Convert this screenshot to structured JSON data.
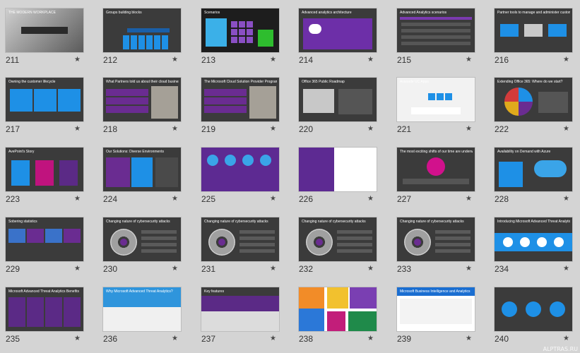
{
  "colors": {
    "background": "#d4d4d4",
    "slide_dark": "#3b3b3b",
    "accent_blue": "#1e90e6",
    "accent_purple": "#6a2c91",
    "accent_magenta": "#d1118c",
    "accent_green": "#2ebd2e"
  },
  "star_glyph": "★",
  "watermark": "ALPTRAS.RU",
  "slides": [
    {
      "number": "211",
      "title": "THE MODERN WORKPLACE",
      "kind": "photo"
    },
    {
      "number": "212",
      "title": "Groups building blocks",
      "kind": "blue_tiles"
    },
    {
      "number": "213",
      "title": "Scenarios",
      "kind": "scenarios"
    },
    {
      "number": "214",
      "title": "Advanced analytics architecture",
      "kind": "architecture"
    },
    {
      "number": "215",
      "title": "Advanced Analytics scenarios",
      "kind": "purple_list"
    },
    {
      "number": "216",
      "title": "Partner tools to manage and administer customers",
      "kind": "tools"
    },
    {
      "number": "217",
      "title": "Owning the customer lifecycle",
      "kind": "blue_three"
    },
    {
      "number": "218",
      "title": "What Partners told us about their cloud business",
      "kind": "partners"
    },
    {
      "number": "219",
      "title": "The Microsoft Cloud Solution Provider Program",
      "kind": "partners"
    },
    {
      "number": "220",
      "title": "Office 365 Public Roadmap",
      "kind": "roadmap"
    },
    {
      "number": "221",
      "title": "Avanade UC Apps",
      "kind": "skype"
    },
    {
      "number": "222",
      "title": "Extending Office 365: Where do we start?",
      "kind": "wheel"
    },
    {
      "number": "223",
      "title": "AvePoint's Story",
      "kind": "story"
    },
    {
      "number": "224",
      "title": "Our Solutions: Diverse Environments",
      "kind": "solutions"
    },
    {
      "number": "225",
      "title": "",
      "kind": "purple_stats"
    },
    {
      "number": "226",
      "title": "",
      "kind": "purple_split"
    },
    {
      "number": "227",
      "title": "The most exciting shifts of our time are underway",
      "kind": "magenta"
    },
    {
      "number": "228",
      "title": "Availability on Demand with Azure",
      "kind": "azure"
    },
    {
      "number": "229",
      "title": "Sobering statistics",
      "kind": "sobering"
    },
    {
      "number": "230",
      "title": "Changing nature of cybersecurity attacks",
      "kind": "cyber"
    },
    {
      "number": "231",
      "title": "Changing nature of cybersecurity attacks",
      "kind": "cyber"
    },
    {
      "number": "232",
      "title": "Changing nature of cybersecurity attacks",
      "kind": "cyber"
    },
    {
      "number": "233",
      "title": "Changing nature of cybersecurity attacks",
      "kind": "cyber"
    },
    {
      "number": "234",
      "title": "Introducing Microsoft Advanced Threat Analytics",
      "kind": "ata_intro"
    },
    {
      "number": "235",
      "title": "Microsoft Advanced Threat Analytics Benefits",
      "kind": "ata_benefits"
    },
    {
      "number": "236",
      "title": "Why Microsoft Advanced Threat Analytics?",
      "kind": "ata_why"
    },
    {
      "number": "237",
      "title": "Key features",
      "kind": "key_features"
    },
    {
      "number": "238",
      "title": "",
      "kind": "bi_tiles"
    },
    {
      "number": "239",
      "title": "Microsoft Business Intelligence and Analytics",
      "kind": "bi_web"
    },
    {
      "number": "240",
      "title": "",
      "kind": "waves"
    }
  ]
}
